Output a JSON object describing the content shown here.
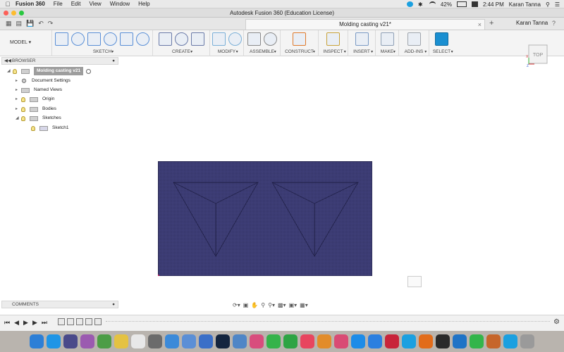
{
  "menubar": {
    "app_name": "Fusion 360",
    "menus": [
      "File",
      "Edit",
      "View",
      "Window",
      "Help"
    ],
    "battery": "42%",
    "time": "2:44 PM",
    "user": "Karan Tanna"
  },
  "window": {
    "title": "Autodesk Fusion 360 (Education License)"
  },
  "tabs": {
    "active_doc": "Molding casting v21*",
    "user": "Karan Tanna"
  },
  "toolbar": {
    "workspace": "MODEL",
    "groups": [
      {
        "label": "SKETCH",
        "icons": [
          "sketch-create-icon",
          "line-icon",
          "rectangle-icon",
          "spline-icon",
          "project-icon",
          "polygon-icon"
        ]
      },
      {
        "label": "CREATE",
        "icons": [
          "extrude-box-icon",
          "sphere-mesh-icon",
          "cylinder-icon"
        ]
      },
      {
        "label": "MODIFY",
        "icons": [
          "press-pull-icon",
          "sigma-icon"
        ]
      },
      {
        "label": "ASSEMBLE",
        "icons": [
          "assemble-icon",
          "joint-icon"
        ]
      },
      {
        "label": "CONSTRUCT",
        "icons": [
          "plane-icon"
        ]
      },
      {
        "label": "INSPECT",
        "icons": [
          "measure-icon"
        ]
      },
      {
        "label": "INSERT",
        "icons": [
          "insert-image-icon"
        ]
      },
      {
        "label": "MAKE",
        "icons": [
          "print-icon"
        ]
      },
      {
        "label": "ADD-INS",
        "icons": [
          "addins-icon"
        ]
      },
      {
        "label": "SELECT",
        "icons": [
          "select-cursor-icon"
        ]
      }
    ],
    "colors": {
      "select_active": "#1a8fd1"
    }
  },
  "browser": {
    "header": "BROWSER",
    "root": "Molding casting v21",
    "items": [
      {
        "label": "Document Settings"
      },
      {
        "label": "Named Views"
      },
      {
        "label": "Origin"
      },
      {
        "label": "Bodies"
      },
      {
        "label": "Sketches"
      },
      {
        "label": "Sketch1"
      }
    ]
  },
  "viewcube": {
    "face_label": "TOP",
    "axis_x": "X",
    "axis_z": "Z"
  },
  "comments": {
    "header": "COMMENTS"
  },
  "canvas": {
    "body_color": "#343466",
    "grid_color": "#6b6bb0"
  },
  "dock": {
    "apps": [
      {
        "name": "finder-icon",
        "color": "#2d7fd6"
      },
      {
        "name": "safari-icon",
        "color": "#1f95e6"
      },
      {
        "name": "siri-icon",
        "color": "#4a4a8a"
      },
      {
        "name": "photos-icon",
        "color": "#9b5ab0"
      },
      {
        "name": "maps-icon",
        "color": "#4c9d46"
      },
      {
        "name": "notes-icon",
        "color": "#e4c242"
      },
      {
        "name": "calendar-icon",
        "color": "#e8e8e8"
      },
      {
        "name": "files-icon",
        "color": "#6b6b6b"
      },
      {
        "name": "chrome-icon",
        "color": "#3b8ad9"
      },
      {
        "name": "preview-icon",
        "color": "#5b8fd6"
      },
      {
        "name": "mail-icon",
        "color": "#3a6fc8"
      },
      {
        "name": "photoshop-icon",
        "color": "#14253f"
      },
      {
        "name": "finder-folder-icon",
        "color": "#4f86c6"
      },
      {
        "name": "photos2-icon",
        "color": "#d84d7d"
      },
      {
        "name": "messages-icon",
        "color": "#35b34a"
      },
      {
        "name": "facetime-icon",
        "color": "#2ea444"
      },
      {
        "name": "music-icon",
        "color": "#e8455f"
      },
      {
        "name": "books-icon",
        "color": "#e28c2a"
      },
      {
        "name": "itunes-icon",
        "color": "#d94b74"
      },
      {
        "name": "appstore-icon",
        "color": "#1d8ce8"
      },
      {
        "name": "sync-icon",
        "color": "#2b7fe0"
      },
      {
        "name": "autocad-icon",
        "color": "#c8243a"
      },
      {
        "name": "skype-icon",
        "color": "#1ba0e0"
      },
      {
        "name": "fusion-icon",
        "color": "#e26c1a"
      },
      {
        "name": "terminal-icon",
        "color": "#2a2a2a"
      },
      {
        "name": "vscode-icon",
        "color": "#1f73c6"
      },
      {
        "name": "whatsapp-icon",
        "color": "#33b54a"
      },
      {
        "name": "eagle-icon",
        "color": "#c6662b"
      },
      {
        "name": "skype2-icon",
        "color": "#1ba0e0"
      },
      {
        "name": "trash-icon",
        "color": "#9a9a9a"
      }
    ]
  }
}
